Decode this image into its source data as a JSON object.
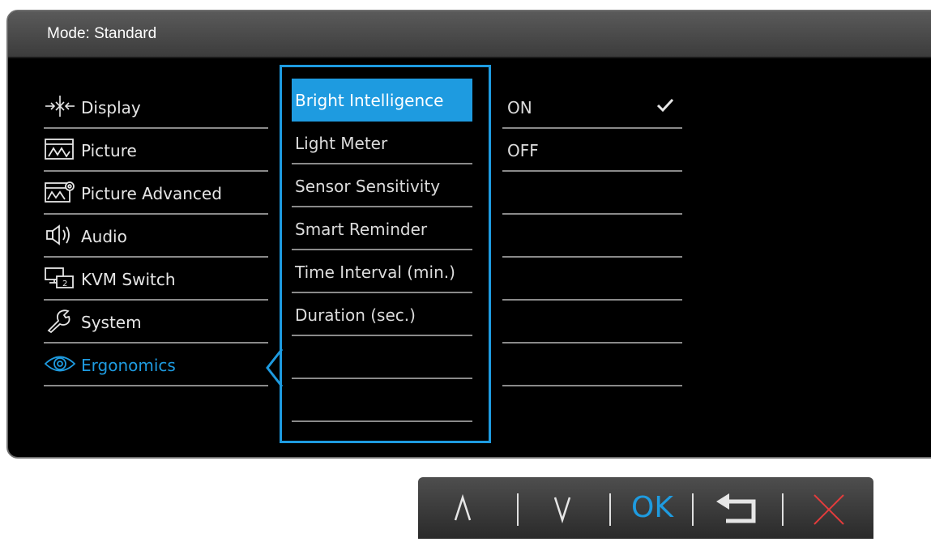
{
  "header": {
    "title": "Mode: Standard"
  },
  "main_menu": {
    "items": [
      {
        "label": "Display",
        "icon": "display-icon",
        "active": false
      },
      {
        "label": "Picture",
        "icon": "picture-icon",
        "active": false
      },
      {
        "label": "Picture Advanced",
        "icon": "picture-advanced-icon",
        "active": false
      },
      {
        "label": "Audio",
        "icon": "audio-icon",
        "active": false
      },
      {
        "label": "KVM Switch",
        "icon": "kvm-switch-icon",
        "active": false
      },
      {
        "label": "System",
        "icon": "wrench-icon",
        "active": false
      },
      {
        "label": "Ergonomics",
        "icon": "eye-icon",
        "active": true
      }
    ]
  },
  "sub_menu": {
    "items": [
      {
        "label": "Bright Intelligence",
        "selected": true
      },
      {
        "label": "Light Meter",
        "selected": false
      },
      {
        "label": "Sensor Sensitivity",
        "selected": false
      },
      {
        "label": "Smart Reminder",
        "selected": false
      },
      {
        "label": "Time Interval (min.)",
        "selected": false
      },
      {
        "label": "Duration (sec.)",
        "selected": false
      }
    ]
  },
  "options": {
    "items": [
      {
        "label": "ON",
        "checked": true
      },
      {
        "label": "OFF",
        "checked": false
      }
    ]
  },
  "button_bar": {
    "up": "up-icon",
    "down": "down-icon",
    "ok_label": "OK",
    "back": "back-icon",
    "exit": "close-icon"
  },
  "colors": {
    "accent": "#1e9be0",
    "exit": "#e23c3c",
    "background": "#000000"
  }
}
